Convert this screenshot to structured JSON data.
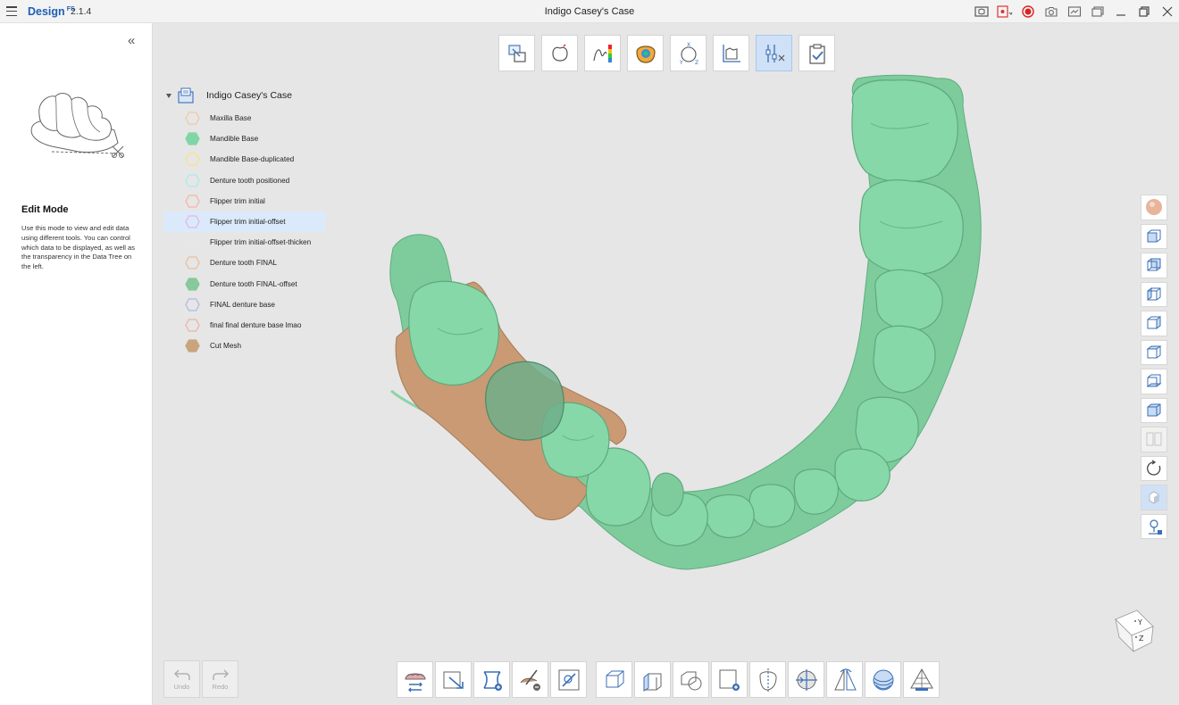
{
  "app": {
    "name": "Design",
    "superscript": "FS",
    "version": "2.1.4",
    "window_title": "Indigo Casey's Case"
  },
  "titlebar_buttons": [
    "view-3d-icon",
    "record-screen-icon",
    "record-icon",
    "camera-icon",
    "screenshot-icon",
    "window-icon",
    "minimize-icon",
    "restore-icon",
    "close-icon"
  ],
  "left_panel": {
    "collapse_label": "«",
    "mode_title": "Edit Mode",
    "mode_description": "Use this mode to view and edit data using different tools. You can control which data to be displayed, as well as the transparency in the Data Tree on the left."
  },
  "top_toolbar": [
    {
      "name": "prepare-tool",
      "active": false
    },
    {
      "name": "margin-tool",
      "active": false
    },
    {
      "name": "thickness-map-tool",
      "active": false
    },
    {
      "name": "occlusion-tool",
      "active": false
    },
    {
      "name": "axis-alignment-tool",
      "active": false
    },
    {
      "name": "measure-tool",
      "active": false
    },
    {
      "name": "edit-tools",
      "active": true
    },
    {
      "name": "checklist-tool",
      "active": false
    }
  ],
  "tree": {
    "root_label": "Indigo Casey's Case",
    "items": [
      {
        "label": "Maxilla Base",
        "color": "#f0c9a4",
        "filled": false,
        "selected": false
      },
      {
        "label": "Mandible Base",
        "color": "#7fd6a4",
        "filled": true,
        "selected": false
      },
      {
        "label": "Mandible Base-duplicated",
        "color": "#f2e58a",
        "filled": false,
        "selected": false
      },
      {
        "label": "Denture tooth positioned",
        "color": "#a7ecec",
        "filled": false,
        "selected": false
      },
      {
        "label": "Flipper trim initial",
        "color": "#f5b5a8",
        "filled": false,
        "selected": false
      },
      {
        "label": "Flipper trim initial-offset",
        "color": "#e3b4ef",
        "filled": false,
        "selected": true
      },
      {
        "label": "Flipper trim initial-offset-thicken",
        "color": "#e8e8e8",
        "filled": false,
        "selected": false
      },
      {
        "label": "Denture tooth FINAL",
        "color": "#e8bf9c",
        "filled": false,
        "selected": false
      },
      {
        "label": "Denture tooth FINAL-offset",
        "color": "#86c99a",
        "filled": true,
        "selected": false
      },
      {
        "label": "FINAL denture base",
        "color": "#b5b8e8",
        "filled": false,
        "selected": false
      },
      {
        "label": "final final denture base lmao",
        "color": "#f0b4a4",
        "filled": false,
        "selected": false
      },
      {
        "label": "Cut Mesh",
        "color": "#c9a47c",
        "filled": true,
        "selected": false
      }
    ]
  },
  "view_toolbar": [
    {
      "name": "material-sphere"
    },
    {
      "name": "view-front"
    },
    {
      "name": "view-back"
    },
    {
      "name": "view-left"
    },
    {
      "name": "view-right"
    },
    {
      "name": "view-top"
    },
    {
      "name": "view-bottom"
    },
    {
      "name": "view-iso"
    },
    {
      "name": "split-view",
      "disabled": true
    },
    {
      "name": "reset-rotation"
    },
    {
      "name": "transparency-toggle",
      "active": true
    },
    {
      "name": "lighting"
    }
  ],
  "orientation": {
    "y_label": "Y",
    "z_label": "Z"
  },
  "undo": {
    "label": "Undo"
  },
  "redo": {
    "label": "Redo"
  },
  "bottom_toolbar": [
    "flip-jaw-tool",
    "transform-tool",
    "smooth-boundary-tool",
    "sculpt-tool",
    "trim-tool",
    "GAP",
    "box-tool",
    "extrude-tool",
    "boolean-tool",
    "add-plane-tool",
    "cut-tool",
    "center-tool",
    "mirror-tool",
    "layers-tool",
    "mesh-simplify-tool"
  ]
}
